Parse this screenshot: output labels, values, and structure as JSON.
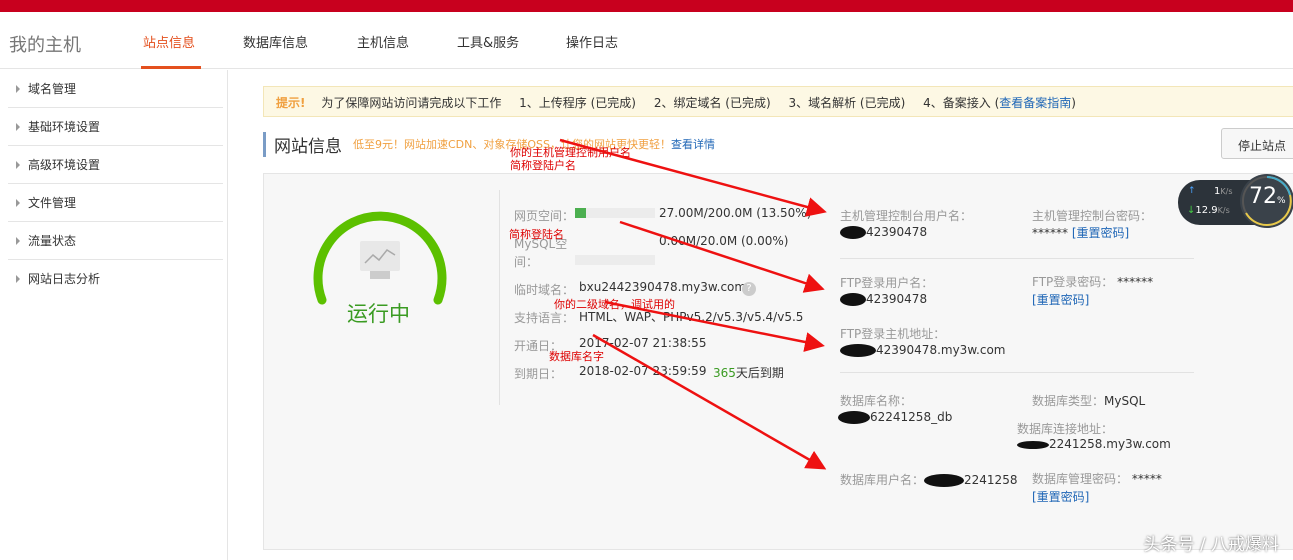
{
  "nav": {
    "brand": "我的主机",
    "tabs": [
      "站点信息",
      "数据库信息",
      "主机信息",
      "工具&服务",
      "操作日志"
    ]
  },
  "sidebar": [
    "域名管理",
    "基础环境设置",
    "高级环境设置",
    "文件管理",
    "流量状态",
    "网站日志分析"
  ],
  "notice": {
    "hint": "提示!",
    "text": "为了保障网站访问请完成以下工作",
    "steps": [
      "1、上传程序 (已完成)",
      "2、绑定域名 (已完成)",
      "3、域名解析 (已完成)"
    ],
    "step4": "4、备案接入 (",
    "step4_link": "查看备案指南",
    "step4_end": ")"
  },
  "title": "网站信息",
  "promo": "低至9元！网站加速CDN、对象存储OSS，让您的网站更快更轻！",
  "promo_link": "查看详情",
  "stop": "停止站点",
  "status": {
    "label": "运行中"
  },
  "info": {
    "web_space_label": "网页空间：",
    "web_space": "27.00M/200.0M (13.50%)",
    "web_space_pct": 13.5,
    "mysql_label1": "MySQL空",
    "mysql_label2": "间：",
    "mysql_space": "0.00M/20.0M (0.00%)",
    "mysql_pct": 0,
    "temp_domain_label": "临时域名：",
    "temp_domain": "bxu2442390478.my3w.com",
    "lang_label": "支持语言：",
    "lang": "HTML、WAP、PHPv5.2/v5.3/v5.4/v5.5",
    "open_label": "开通日：",
    "open": "2017-02-07 21:38:55",
    "expire_label": "到期日：",
    "expire": "2018-02-07 23:59:59",
    "days": "365",
    "days_suffix": "天后到期"
  },
  "creds": {
    "host_user_label": "主机管理控制台用户名：",
    "host_user": "42390478",
    "host_pw_label": "主机管理控制台密码：",
    "host_pw": "******",
    "reset": "[重置密码]",
    "ftp_user_label": "FTP登录用户名：",
    "ftp_user": "42390478",
    "ftp_pw_label": "FTP登录密码：",
    "ftp_pw": "******",
    "ftp_host_label": "FTP登录主机地址：",
    "ftp_host": "42390478.my3w.com",
    "db_name_label": "数据库名称：",
    "db_name": "62241258_db",
    "db_type_label": "数据库类型：",
    "db_type": "MySQL",
    "db_addr_label": "数据库连接地址：",
    "db_addr": "2241258.my3w.com",
    "db_user_label": "数据库用户名：",
    "db_user": "2241258",
    "db_pw_label": "数据库管理密码：",
    "db_pw": "*****"
  },
  "annotations": [
    "你的主机管理控制用户名",
    "简称登陆户名",
    "简称登陆名",
    "你的二级域名，调试用的",
    "数据库名字"
  ],
  "speed": {
    "up": "1",
    "down": "12.9",
    "unit": "K/s",
    "percent": "72",
    "pct_sign": "%"
  },
  "watermark": "头条号 / 八戒爆料"
}
